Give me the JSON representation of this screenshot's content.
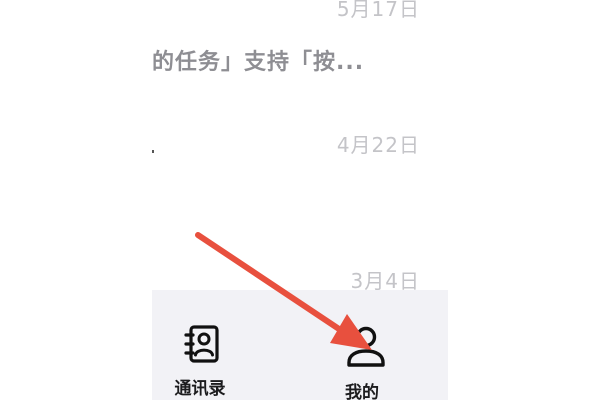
{
  "message_list": {
    "items": [
      {
        "date": "5月17日",
        "preview": "的任务」支持「按..."
      },
      {
        "date": "4月22日",
        "preview": ""
      },
      {
        "date": "3月4日",
        "preview": ""
      }
    ]
  },
  "tabbar": {
    "tabs": [
      {
        "label": "通讯录",
        "icon": "contacts-book-icon"
      },
      {
        "label": "我的",
        "icon": "person-icon"
      }
    ]
  },
  "annotation": {
    "arrow_color": "#e8503e"
  }
}
